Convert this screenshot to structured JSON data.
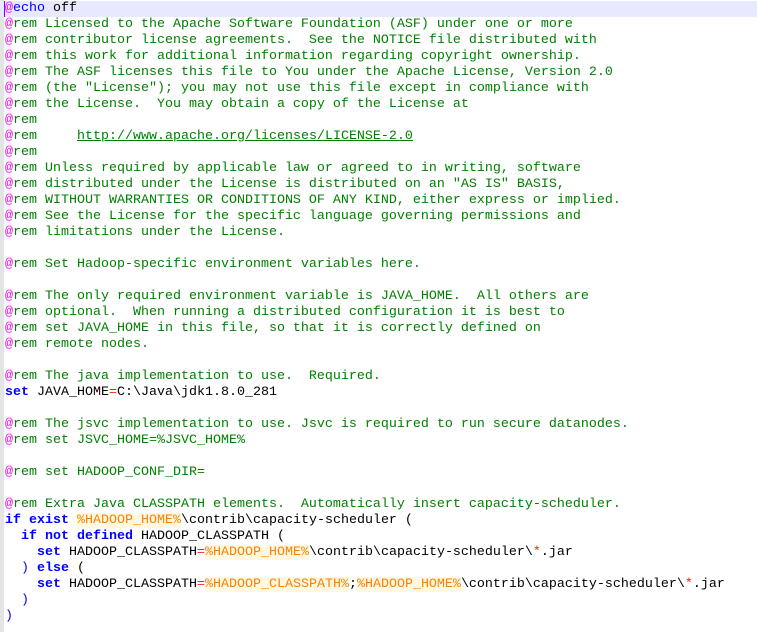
{
  "editor": {
    "current_line": 0,
    "colors": {
      "at": "#ff00ff",
      "keyword": "#0000ff",
      "comment": "#008000",
      "variable": "#ff8000",
      "operator": "#ff2000"
    },
    "lines": [
      [
        [
          "at",
          "@"
        ],
        [
          "echo",
          "echo"
        ],
        [
          "txt",
          " off"
        ]
      ],
      [
        [
          "at",
          "@"
        ],
        [
          "com",
          "rem Licensed to the Apache Software Foundation (ASF) under one or more"
        ]
      ],
      [
        [
          "at",
          "@"
        ],
        [
          "com",
          "rem contributor license agreements.  See the NOTICE file distributed with"
        ]
      ],
      [
        [
          "at",
          "@"
        ],
        [
          "com",
          "rem this work for additional information regarding copyright ownership."
        ]
      ],
      [
        [
          "at",
          "@"
        ],
        [
          "com",
          "rem The ASF licenses this file to You under the Apache License, Version 2.0"
        ]
      ],
      [
        [
          "at",
          "@"
        ],
        [
          "com",
          "rem (the \"License\"); you may not use this file except in compliance with"
        ]
      ],
      [
        [
          "at",
          "@"
        ],
        [
          "com",
          "rem the License.  You may obtain a copy of the License at"
        ]
      ],
      [
        [
          "at",
          "@"
        ],
        [
          "com",
          "rem"
        ]
      ],
      [
        [
          "at",
          "@"
        ],
        [
          "com",
          "rem     "
        ],
        [
          "url",
          "http://www.apache.org/licenses/LICENSE-2.0"
        ]
      ],
      [
        [
          "at",
          "@"
        ],
        [
          "com",
          "rem"
        ]
      ],
      [
        [
          "at",
          "@"
        ],
        [
          "com",
          "rem Unless required by applicable law or agreed to in writing, software"
        ]
      ],
      [
        [
          "at",
          "@"
        ],
        [
          "com",
          "rem distributed under the License is distributed on an \"AS IS\" BASIS,"
        ]
      ],
      [
        [
          "at",
          "@"
        ],
        [
          "com",
          "rem WITHOUT WARRANTIES OR CONDITIONS OF ANY KIND, either express or implied."
        ]
      ],
      [
        [
          "at",
          "@"
        ],
        [
          "com",
          "rem See the License for the specific language governing permissions and"
        ]
      ],
      [
        [
          "at",
          "@"
        ],
        [
          "com",
          "rem limitations under the License."
        ]
      ],
      [],
      [
        [
          "at",
          "@"
        ],
        [
          "com",
          "rem Set Hadoop-specific environment variables here."
        ]
      ],
      [],
      [
        [
          "at",
          "@"
        ],
        [
          "com",
          "rem The only required environment variable is JAVA_HOME.  All others are"
        ]
      ],
      [
        [
          "at",
          "@"
        ],
        [
          "com",
          "rem optional.  When running a distributed configuration it is best to"
        ]
      ],
      [
        [
          "at",
          "@"
        ],
        [
          "com",
          "rem set JAVA_HOME in this file, so that it is correctly defined on"
        ]
      ],
      [
        [
          "at",
          "@"
        ],
        [
          "com",
          "rem remote nodes."
        ]
      ],
      [],
      [
        [
          "at",
          "@"
        ],
        [
          "com",
          "rem The java implementation to use.  Required."
        ]
      ],
      [
        [
          "kw",
          "set"
        ],
        [
          "txt",
          " JAVA_HOME"
        ],
        [
          "op",
          "="
        ],
        [
          "txt",
          "C:\\Java\\jdk1.8.0_281"
        ]
      ],
      [],
      [
        [
          "at",
          "@"
        ],
        [
          "com",
          "rem The jsvc implementation to use. Jsvc is required to run secure datanodes."
        ]
      ],
      [
        [
          "at",
          "@"
        ],
        [
          "com",
          "rem set JSVC_HOME=%JSVC_HOME%"
        ]
      ],
      [],
      [
        [
          "at",
          "@"
        ],
        [
          "com",
          "rem set HADOOP_CONF_DIR="
        ]
      ],
      [],
      [
        [
          "at",
          "@"
        ],
        [
          "com",
          "rem Extra Java CLASSPATH elements.  Automatically insert capacity-scheduler."
        ]
      ],
      [
        [
          "kw",
          "if"
        ],
        [
          "txt",
          " "
        ],
        [
          "kw",
          "exist"
        ],
        [
          "txt",
          " "
        ],
        [
          "var",
          "%HADOOP_HOME%"
        ],
        [
          "txt",
          "\\contrib\\capacity-scheduler ("
        ]
      ],
      [
        [
          "txt",
          "  "
        ],
        [
          "kw",
          "if"
        ],
        [
          "txt",
          " "
        ],
        [
          "kw",
          "not"
        ],
        [
          "txt",
          " "
        ],
        [
          "kw",
          "defined"
        ],
        [
          "txt",
          " HADOOP_CLASSPATH ("
        ]
      ],
      [
        [
          "txt",
          "    "
        ],
        [
          "kw",
          "set"
        ],
        [
          "txt",
          " HADOOP_CLASSPATH"
        ],
        [
          "op",
          "="
        ],
        [
          "var",
          "%HADOOP_HOME%"
        ],
        [
          "txt",
          "\\contrib\\capacity-scheduler\\"
        ],
        [
          "op",
          "*"
        ],
        [
          "txt",
          ".jar"
        ]
      ],
      [
        [
          "txt",
          "  "
        ],
        [
          "par",
          ")"
        ],
        [
          "txt",
          " "
        ],
        [
          "kw",
          "else"
        ],
        [
          "txt",
          " ("
        ]
      ],
      [
        [
          "txt",
          "    "
        ],
        [
          "kw",
          "set"
        ],
        [
          "txt",
          " HADOOP_CLASSPATH"
        ],
        [
          "op",
          "="
        ],
        [
          "var",
          "%HADOOP_CLASSPATH%"
        ],
        [
          "txt",
          ";"
        ],
        [
          "var",
          "%HADOOP_HOME%"
        ],
        [
          "txt",
          "\\contrib\\capacity-scheduler\\"
        ],
        [
          "op",
          "*"
        ],
        [
          "txt",
          ".jar"
        ]
      ],
      [
        [
          "txt",
          "  "
        ],
        [
          "par",
          ")"
        ]
      ],
      [
        [
          "par",
          ")"
        ]
      ]
    ]
  }
}
